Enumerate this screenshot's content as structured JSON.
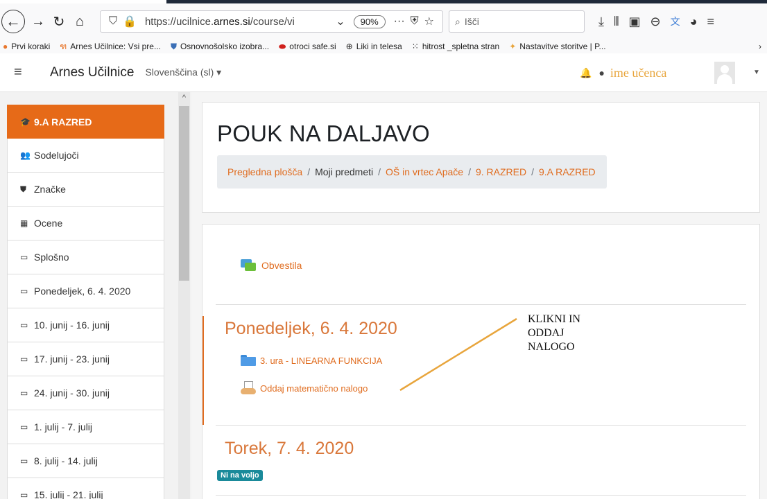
{
  "browser": {
    "url_prefix": "https://ucilnice.",
    "url_domain": "arnes.si",
    "url_rest": "/course/vi",
    "zoom": "90%",
    "search_placeholder": "Išči",
    "bookmarks": [
      {
        "label": "Prvi koraki",
        "icon": "firefox-icon"
      },
      {
        "label": "Arnes Učilnice: Vsi pre...",
        "icon": "moodle-icon"
      },
      {
        "label": "Osnovnošolsko izobra...",
        "icon": "shield-icon"
      },
      {
        "label": "otroci safe.si",
        "icon": "lips-icon"
      },
      {
        "label": "Liki in telesa",
        "icon": "globe-icon"
      },
      {
        "label": "hitrost _spletna stran",
        "icon": "dots-icon"
      },
      {
        "label": "Nastavitve storitve | P...",
        "icon": "star-icon"
      }
    ]
  },
  "navbar": {
    "brand": "Arnes Učilnice",
    "language": "Slovenščina (sl) ▾",
    "username": "ime učenca"
  },
  "drawer": {
    "items": [
      {
        "label": "9.A RAZRED",
        "icon": "graduation-cap-icon",
        "glyph": "🎓"
      },
      {
        "label": "Sodelujoči",
        "icon": "users-icon",
        "glyph": "👥"
      },
      {
        "label": "Značke",
        "icon": "badge-shield-icon",
        "glyph": "⛊"
      },
      {
        "label": "Ocene",
        "icon": "table-icon",
        "glyph": "▦"
      },
      {
        "label": "Splošno",
        "icon": "folder-icon",
        "glyph": "▭"
      },
      {
        "label": "Ponedeljek, 6. 4. 2020",
        "icon": "folder-icon",
        "glyph": "▭"
      },
      {
        "label": "10. junij - 16. junij",
        "icon": "folder-icon",
        "glyph": "▭"
      },
      {
        "label": "17. junij - 23. junij",
        "icon": "folder-icon",
        "glyph": "▭"
      },
      {
        "label": "24. junij - 30. junij",
        "icon": "folder-icon",
        "glyph": "▭"
      },
      {
        "label": "1. julij - 7. julij",
        "icon": "folder-icon",
        "glyph": "▭"
      },
      {
        "label": "8. julij - 14. julij",
        "icon": "folder-icon",
        "glyph": "▭"
      },
      {
        "label": "15. julij - 21. julij",
        "icon": "folder-icon",
        "glyph": "▭"
      }
    ]
  },
  "page": {
    "title": "POUK NA DALJAVO",
    "breadcrumb": [
      "Pregledna plošča",
      "Moji predmeti",
      "OŠ in vrtec Apače",
      "9. RAZRED",
      "9.A RAZRED"
    ],
    "announcements": "Obvestila",
    "section1": {
      "title": "Ponedeljek, 6. 4. 2020",
      "folder": "3. ura - LINEARNA FUNKCIJA",
      "assignment": "Oddaj matematično nalogo"
    },
    "section2": {
      "title": "Torek, 7. 4. 2020",
      "badge": "Ni na voljo"
    },
    "note": "KLIKNI IN\nODDAJ\nNALOGO"
  },
  "colors": {
    "accent": "#e06c1f",
    "drawer_active": "#e66a18",
    "username": "#e8a53c",
    "badge": "#1a8a9a"
  }
}
